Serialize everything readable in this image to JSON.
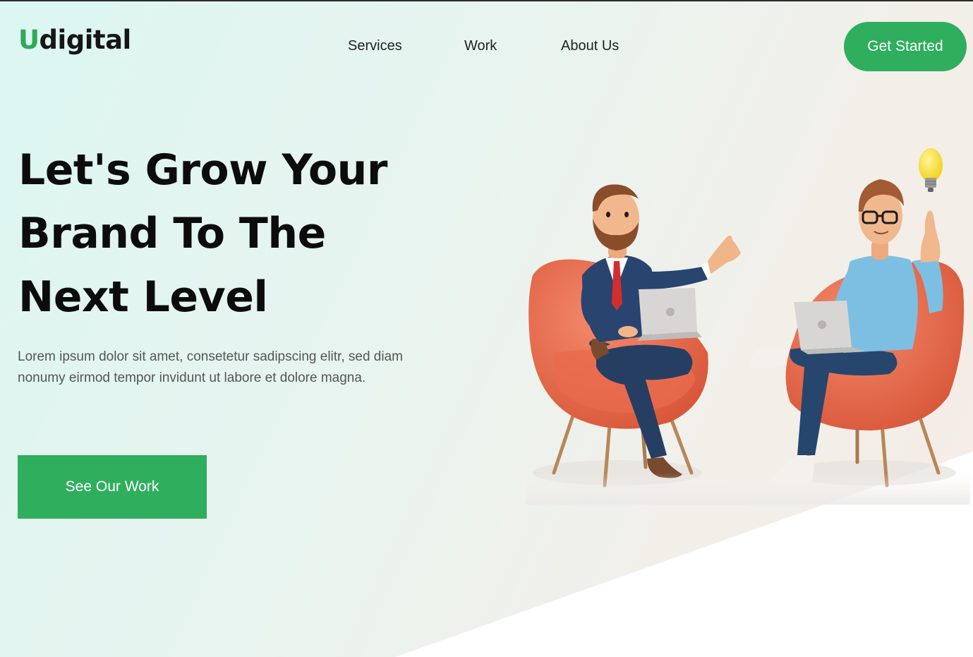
{
  "brand": {
    "logo_first": "U",
    "logo_rest": "digital",
    "accent_color": "#2fae5d"
  },
  "nav": {
    "items": [
      {
        "label": "Services"
      },
      {
        "label": "Work"
      },
      {
        "label": "About Us"
      }
    ]
  },
  "header": {
    "cta_label": "Get Started"
  },
  "hero": {
    "title_lines": [
      "Let's Grow Your",
      "Brand To The",
      "Next Level"
    ],
    "description": "Lorem ipsum dolor sit amet, consetetur sadipscing elitr, sed diam nonumy eirmod tempor invidunt ut labore et dolore magna.",
    "cta_label": "See Our Work"
  },
  "illustration": {
    "icon": "two-people-in-armchairs-with-laptops-and-lightbulb"
  }
}
